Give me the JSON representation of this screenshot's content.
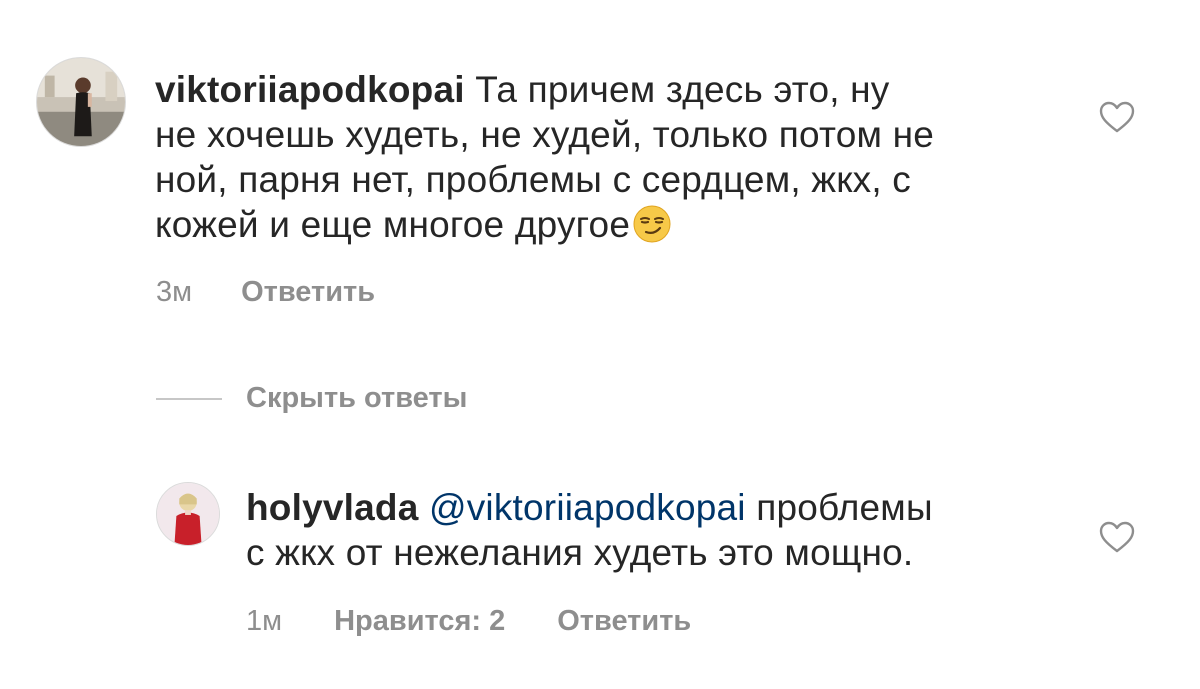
{
  "comments": [
    {
      "username": "viktoriiapodkopai",
      "mention": "",
      "text_lines": [
        "Та причем здесь это, ну",
        "не хочешь худеть, не худей, только потом не",
        "ной, парня нет, проблемы с сердцем, жкх, с",
        "кожей и еще многое другое"
      ],
      "emoji": "smirking-face-emoji",
      "time": "3м",
      "likes_label": "",
      "reply_label": "Ответить"
    },
    {
      "username": "holyvlada",
      "mention": "@viktoriiapodkopai",
      "text_lines": [
        "проблемы",
        "с жкх от нежелания худеть это мощно."
      ],
      "time": "1м",
      "likes_label": "Нравится: 2",
      "reply_label": "Ответить"
    }
  ],
  "hide_replies_label": "Скрыть ответы",
  "colors": {
    "text": "#262626",
    "muted": "#8e8e8e",
    "mention": "#003569",
    "divider": "#c7c7c7"
  }
}
